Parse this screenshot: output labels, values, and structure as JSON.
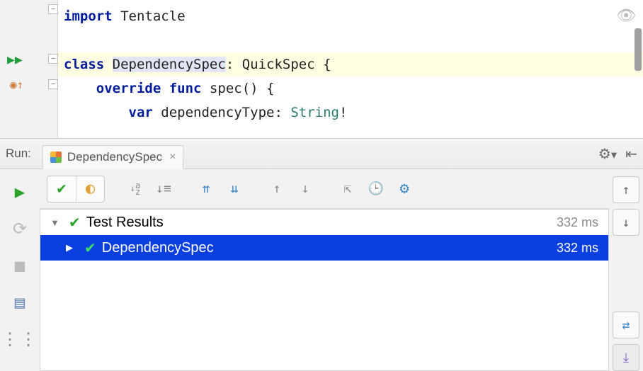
{
  "editor": {
    "line1": {
      "kw": "import",
      "module": "Tentacle"
    },
    "line3": {
      "kw_class": "class",
      "class_name": "DependencySpec",
      "sep": ": ",
      "super": "QuickSpec",
      "brace": " {"
    },
    "line4": {
      "kw_override": "override",
      "kw_func": "func",
      "fn": "spec() {"
    },
    "line5": {
      "kw_var": "var",
      "varname": "dependencyType: ",
      "type": "String",
      "bang": "!"
    }
  },
  "run_header": {
    "label": "Run:",
    "tab": "DependencySpec"
  },
  "toolbar": {
    "sort_label": "a\nz"
  },
  "results": {
    "root": {
      "label": "Test Results",
      "time": "332 ms"
    },
    "child": {
      "label": "DependencySpec",
      "time": "332 ms"
    }
  }
}
